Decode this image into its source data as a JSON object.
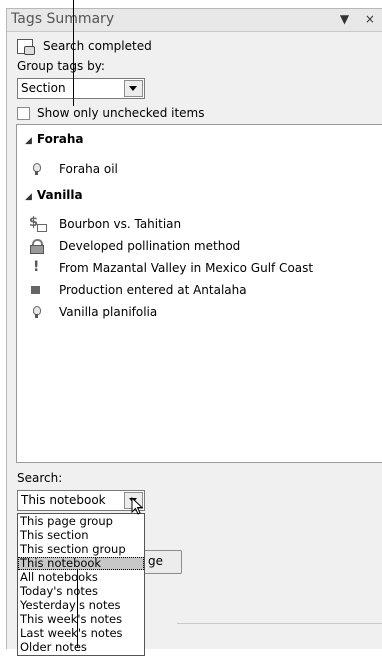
{
  "pane": {
    "title": "Tags Summary",
    "controls": "▼ ×"
  },
  "status": {
    "text": "Search completed"
  },
  "group": {
    "label": "Group tags by:",
    "value": "Section"
  },
  "filter": {
    "label": "Show only unchecked items"
  },
  "sections": [
    {
      "name": "Foraha",
      "items": [
        {
          "icon": "lightbulb-icon",
          "label": "Foraha oil"
        }
      ]
    },
    {
      "name": "Vanilla",
      "items": [
        {
          "icon": "dollar-icon",
          "label": "Bourbon vs. Tahitian"
        },
        {
          "icon": "lock-icon",
          "label": "Developed pollination method"
        },
        {
          "icon": "exclamation-icon",
          "label": "From Mazantal Valley in Mexico Gulf Coast"
        },
        {
          "icon": "square-icon",
          "label": "Production entered at Antalaha"
        },
        {
          "icon": "lightbulb-icon",
          "label": "Vanilla planifolia"
        }
      ]
    }
  ],
  "search": {
    "label": "Search:",
    "value": "This notebook",
    "options": [
      "This page group",
      "This section",
      "This section group",
      "This notebook",
      "All notebooks",
      "Today's notes",
      "Yesterday's notes",
      "This week's notes",
      "Last week's notes",
      "Older notes"
    ],
    "selected_index": 3
  },
  "obscured_button": {
    "visible_text": "ge"
  }
}
